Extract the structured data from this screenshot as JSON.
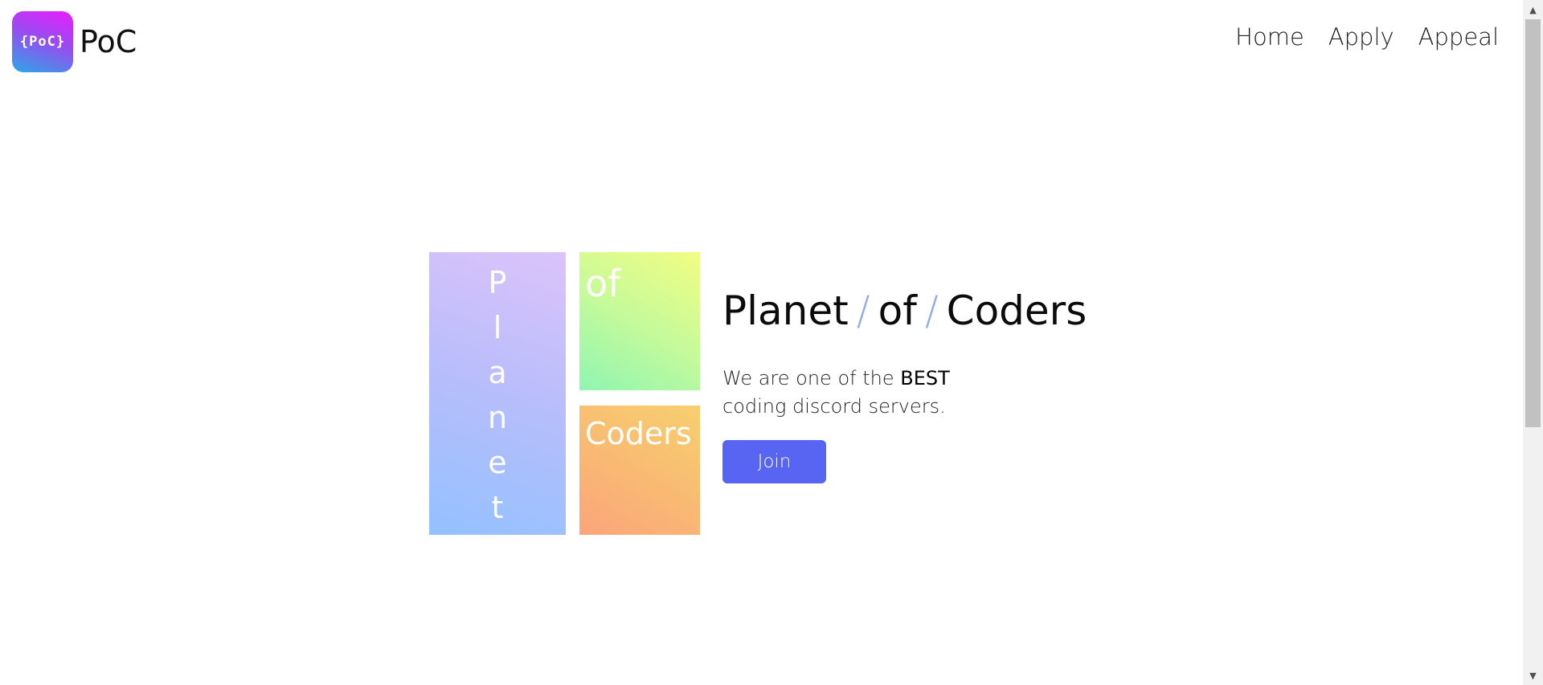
{
  "header": {
    "logo_text": "{PoC}",
    "brand_name": "PoC",
    "nav": [
      "Home",
      "Apply",
      "Appeal"
    ]
  },
  "hero": {
    "tiles": {
      "planet_letters": [
        "P",
        "l",
        "a",
        "n",
        "e",
        "t"
      ],
      "of": "of",
      "coders": "Coders"
    },
    "title": {
      "word1": "Planet",
      "separator": "/",
      "word2": "of",
      "word3": "Coders"
    },
    "description": {
      "line1_prefix": "We are one of the ",
      "emphasis": "BEST",
      "line2": "coding discord servers."
    },
    "join_label": "Join"
  },
  "colors": {
    "button": "#5865f2",
    "slash": "#93aee6",
    "logo_gradient": [
      "#e91dff",
      "#2aa7e8"
    ]
  },
  "icons": {
    "scroll_up": "triangle-up-icon",
    "scroll_down": "triangle-down-icon"
  }
}
